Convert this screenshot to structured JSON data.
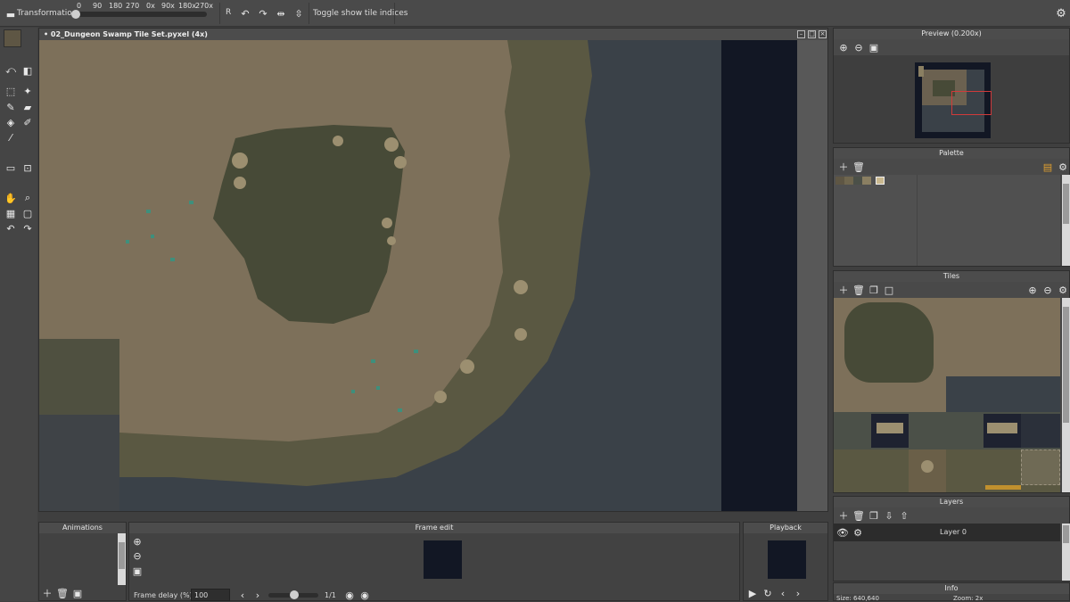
{
  "toolbar": {
    "transformation_label": "Transformation",
    "degrees": [
      "0",
      "90",
      "180",
      "270",
      "0x",
      "90x",
      "180x",
      "270x"
    ],
    "rotate_reset_label": "R",
    "toggle_tile_indices_label": "Toggle show tile indices"
  },
  "canvas": {
    "title": "• 02_Dungeon Swamp Tile Set.pyxel  (4x)"
  },
  "animations": {
    "title": "Animations"
  },
  "frame_edit": {
    "title": "Frame edit",
    "frame_delay_label": "Frame delay (%)",
    "frame_delay_value": "100",
    "frame_counter": "1/1"
  },
  "playback": {
    "title": "Playback"
  },
  "preview": {
    "title": "Preview (0.200x)"
  },
  "palette": {
    "title": "Palette",
    "swatches": [
      "#5e5644",
      "#6f664e",
      "#4b5048",
      "#8a7f62",
      "#c9b88f"
    ]
  },
  "tiles": {
    "title": "Tiles"
  },
  "layers": {
    "title": "Layers",
    "items": [
      {
        "label": "Layer 0"
      }
    ]
  },
  "info": {
    "title": "Info",
    "size": "Size: 640,640",
    "zoom": "Zoom: 2x"
  },
  "colors": {
    "sand": "#7d705a",
    "swamp": "#474a37",
    "water": "#3a4148",
    "void": "#121724",
    "foliage": "#5a5842"
  }
}
